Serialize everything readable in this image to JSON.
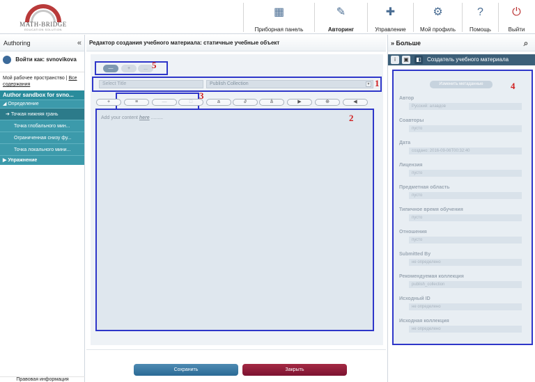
{
  "logo": {
    "name": "MATH-BRIDGE",
    "tagline": "EDUCATION SOLUTION"
  },
  "nav": [
    {
      "id": "dashboard",
      "label": "Приборная панель",
      "icon": "dashboard-icon"
    },
    {
      "id": "authoring",
      "label": "Авторинг",
      "icon": "authoring-icon",
      "active": true
    },
    {
      "id": "management",
      "label": "Управление",
      "icon": "management-icon"
    },
    {
      "id": "profile",
      "label": "Мой профиль",
      "icon": "gear-icon"
    },
    {
      "id": "help",
      "label": "Помощь",
      "icon": "help-icon"
    },
    {
      "id": "logout",
      "label": "Выйти",
      "icon": "logout-icon"
    }
  ],
  "left": {
    "title": "Authoring",
    "user": "Войти как: svnovikova",
    "links": {
      "workspace": "Мой рабочее пространство",
      "sep": " | ",
      "all": "Все содержания"
    },
    "sandbox": "Author sandbox for svno...",
    "groups": [
      {
        "label": "◢ Определение",
        "items": [
          {
            "label": "Точкая нижняя грань",
            "selected": true
          },
          {
            "label": "Точка глобального мин..."
          },
          {
            "label": "Ограниченная снизу фу..."
          },
          {
            "label": "Точка локального мини..."
          }
        ]
      },
      {
        "label": "▶ Упражнение",
        "items": []
      }
    ],
    "footer": "Правовая информация"
  },
  "center": {
    "title": "Редактор создания учебного материала: статичные учебные объект",
    "input_placeholder": "Select Title",
    "collection": "Publish Collection",
    "editor_placeholder_pre": "Add your content ",
    "editor_placeholder_link": "here",
    "editor_placeholder_post": " .........",
    "save": "Сохранить",
    "close": "Закрыть",
    "tabs": [
      "—",
      "+",
      "..."
    ],
    "toolbar": [
      "+",
      "≡",
      "—",
      "□",
      "a",
      "∂",
      "å",
      "▶",
      "⊕",
      "◀"
    ]
  },
  "right": {
    "title": "Больше",
    "tab_label": "Создатель учебного материала",
    "edit_button": "Изменить метаданные",
    "fields": [
      {
        "k": "Автор",
        "v": "Русский: aлавдов"
      },
      {
        "k": "Соавторы",
        "v": "пусто"
      },
      {
        "k": "Дата",
        "v": "создано: 2016-09-06T00:32:40"
      },
      {
        "k": "Лицензия",
        "v": "пусто"
      },
      {
        "k": "Предметная область",
        "v": "пусто"
      },
      {
        "k": "Типичное время обучения",
        "v": "пусто"
      },
      {
        "k": "Отношения",
        "v": "пусто"
      },
      {
        "k": "Submitted By",
        "v": "не определено"
      },
      {
        "k": "Рекомендуемая коллекция",
        "v": "publish_collection"
      },
      {
        "k": "Исходный ID",
        "v": "не определено"
      },
      {
        "k": "Исходная коллекция",
        "v": "не определено"
      }
    ]
  },
  "annotations": {
    "a1": "1",
    "a2": "2",
    "a3": "3",
    "a4": "4",
    "a5": "5"
  }
}
